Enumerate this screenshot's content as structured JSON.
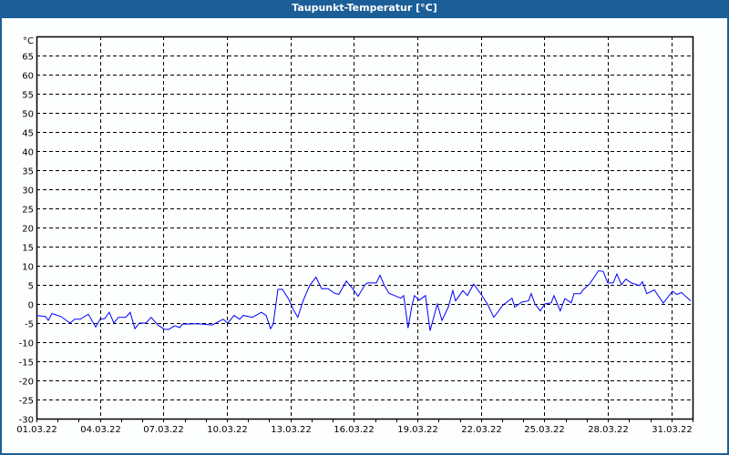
{
  "window": {
    "title": "Taupunkt-Temperatur [°C]"
  },
  "colors": {
    "titlebar": "#1c5f98",
    "series": "#0000ff",
    "grid": "#000000"
  },
  "chart_data": {
    "type": "line",
    "title": "Taupunkt-Temperatur [°C]",
    "ylabel": "°C",
    "xlabel": "",
    "ylim": [
      -30,
      70
    ],
    "xlim_days": [
      0,
      31
    ],
    "yticks": [
      -30,
      -25,
      -20,
      -15,
      -10,
      -5,
      0,
      5,
      10,
      15,
      20,
      25,
      30,
      35,
      40,
      45,
      50,
      55,
      60,
      65
    ],
    "xtick_labels": [
      "01.03.22",
      "04.03.22",
      "07.03.22",
      "10.03.22",
      "13.03.22",
      "16.03.22",
      "19.03.22",
      "22.03.22",
      "25.03.22",
      "28.03.22",
      "31.03.22"
    ],
    "xtick_days": [
      0,
      3,
      6,
      9,
      12,
      15,
      18,
      21,
      24,
      27,
      30
    ],
    "grid": true,
    "legend": "none",
    "series": [
      {
        "name": "Taupunkt",
        "x_days": [
          0,
          0.43,
          0.56,
          0.73,
          1.16,
          1.59,
          1.81,
          2.07,
          2.45,
          2.8,
          3.01,
          3.23,
          3.44,
          3.66,
          3.87,
          4.22,
          4.43,
          4.65,
          4.86,
          5.17,
          5.42,
          5.73,
          6.03,
          6.24,
          6.54,
          6.76,
          6.89,
          7.62,
          8.31,
          8.82,
          9.04,
          9.34,
          9.6,
          9.77,
          10.2,
          10.63,
          10.85,
          11.06,
          11.19,
          11.41,
          11.62,
          11.92,
          12.14,
          12.35,
          12.61,
          12.91,
          13.21,
          13.47,
          13.78,
          14.08,
          14.29,
          14.64,
          14.94,
          15.2,
          15.5,
          15.63,
          16.06,
          16.23,
          16.44,
          16.66,
          17.22,
          17.35,
          17.56,
          17.74,
          17.86,
          18.08,
          18.38,
          18.6,
          18.94,
          19.16,
          19.46,
          19.67,
          19.8,
          20.15,
          20.36,
          20.66,
          21.01,
          21.31,
          21.61,
          22.04,
          22.47,
          22.6,
          22.94,
          23.25,
          23.38,
          23.55,
          23.81,
          24.02,
          24.32,
          24.45,
          24.75,
          24.97,
          25.27,
          25.4,
          25.7,
          25.83,
          26.13,
          26.56,
          26.78,
          26.99,
          27.25,
          27.42,
          27.64,
          27.85,
          28.11,
          28.5,
          28.63,
          28.84,
          29.19,
          29.62,
          30.05,
          30.26,
          30.48,
          30.91
        ],
        "values": [
          -3,
          -3.3,
          -4.3,
          -2.5,
          -3.3,
          -5,
          -4,
          -4,
          -2.7,
          -6,
          -4,
          -3.8,
          -2.2,
          -5,
          -3.5,
          -3.5,
          -2.2,
          -6.5,
          -5,
          -5,
          -3.5,
          -5.5,
          -6.6,
          -6.7,
          -5.7,
          -6.2,
          -5.3,
          -5.2,
          -5.5,
          -4,
          -5,
          -3,
          -4,
          -3,
          -3.5,
          -2.2,
          -3,
          -6.5,
          -5.2,
          3.8,
          3.8,
          1.2,
          -1.5,
          -3.5,
          1,
          4.8,
          7,
          4,
          4,
          2.8,
          2.5,
          6,
          4,
          2,
          4.8,
          5.5,
          5.5,
          7.5,
          4.8,
          2.8,
          1.5,
          2.2,
          -6.3,
          -0.5,
          2.2,
          1,
          2.2,
          -7,
          0,
          -4.3,
          -0.8,
          3.5,
          0.8,
          3.5,
          2.2,
          5.2,
          2.5,
          0,
          -3.5,
          -0.3,
          1.5,
          -0.8,
          0.5,
          0.8,
          2.7,
          0,
          -1.8,
          0,
          0.3,
          2.2,
          -1.8,
          1.4,
          0.3,
          2.7,
          2.7,
          3.7,
          5.2,
          8.7,
          8.5,
          5.5,
          5.5,
          7.8,
          5,
          6.5,
          5.5,
          4.8,
          5.8,
          2.7,
          3.7,
          0.2,
          3.3,
          2.5,
          3,
          0.8
        ]
      }
    ]
  }
}
